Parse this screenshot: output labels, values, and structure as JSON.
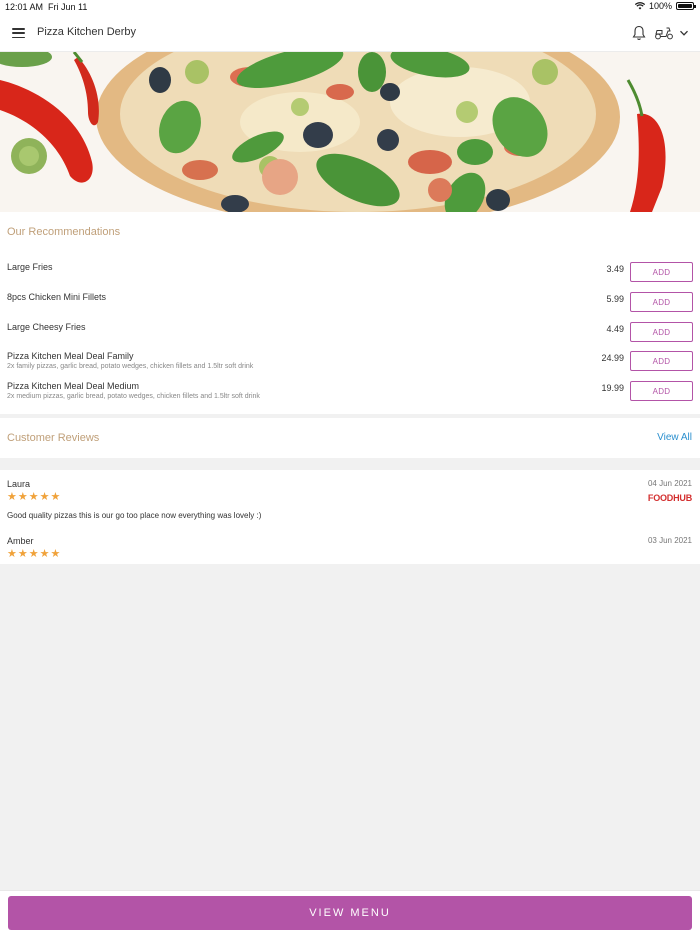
{
  "status_bar": {
    "time": "12:01 AM",
    "date": "Fri Jun 11",
    "battery": "100%",
    "icons": [
      "wifi-icon",
      "battery-icon"
    ]
  },
  "header": {
    "title": "Pizza Kitchen Derby",
    "icons": [
      "menu-icon",
      "bell-icon",
      "delivery-scooter-icon",
      "chevron-down-icon"
    ]
  },
  "hero": {
    "image": "pizza-banner"
  },
  "recommendations": {
    "title": "Our Recommendations",
    "add_label": "ADD",
    "items": [
      {
        "name": "Large Fries",
        "description": "",
        "price": "3.49"
      },
      {
        "name": "8pcs Chicken Mini Fillets",
        "description": "",
        "price": "5.99"
      },
      {
        "name": "Large Cheesy Fries",
        "description": "",
        "price": "4.49"
      },
      {
        "name": "Pizza Kitchen Meal Deal Family",
        "description": "2x family pizzas, garlic bread, potato wedges, chicken fillets and 1.5ltr soft drink",
        "price": "24.99"
      },
      {
        "name": "Pizza Kitchen Meal Deal Medium",
        "description": "2x medium pizzas, garlic bread, potato wedges, chicken fillets and 1.5ltr soft drink",
        "price": "19.99"
      }
    ]
  },
  "reviews": {
    "title": "Customer Reviews",
    "view_all": "View All",
    "items": [
      {
        "name": "Laura",
        "date": "04 Jun 2021",
        "rating": 5,
        "text": "Good quality pizzas this is our go too place now everything was lovely :)",
        "source": "FOODHUB"
      },
      {
        "name": "Amber",
        "date": "03 Jun 2021",
        "rating": 5,
        "text": "",
        "source": ""
      }
    ]
  },
  "footer": {
    "button": "VIEW MENU"
  },
  "colors": {
    "accent": "#b354a7",
    "section_title": "#c0a07a",
    "link": "#2b8fce",
    "star": "#f0a23a",
    "foodhub": "#d32f2f"
  }
}
